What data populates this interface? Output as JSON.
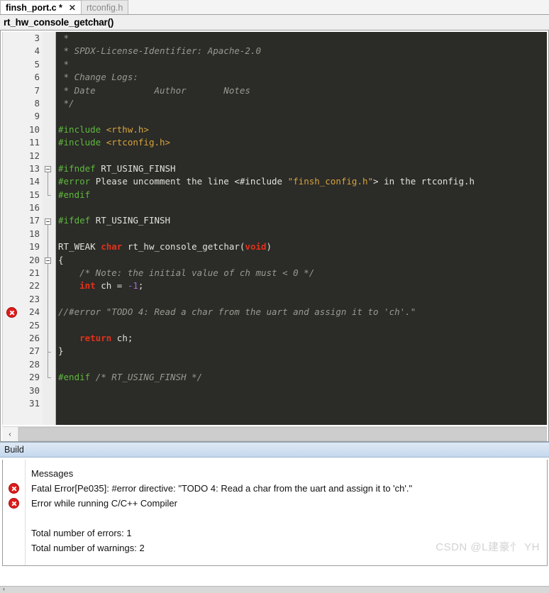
{
  "tabs": [
    {
      "label": "finsh_port.c *",
      "active": true,
      "close_icon": "✕"
    },
    {
      "label": "rtconfig.h",
      "active": false
    }
  ],
  "navbar": {
    "function_title": "rt_hw_console_getchar()"
  },
  "editor": {
    "first_visible_line": 3,
    "last_visible_line": 31,
    "error_line": 24,
    "lines": [
      {
        "n": 3,
        "tokens": [
          {
            "t": " * ",
            "c": "cmt"
          }
        ]
      },
      {
        "n": 4,
        "tokens": [
          {
            "t": " * SPDX-License-Identifier: Apache-2.0",
            "c": "cmt"
          }
        ]
      },
      {
        "n": 5,
        "tokens": [
          {
            "t": " * ",
            "c": "cmt"
          }
        ]
      },
      {
        "n": 6,
        "tokens": [
          {
            "t": " * Change Logs:",
            "c": "cmt"
          }
        ]
      },
      {
        "n": 7,
        "tokens": [
          {
            "t": " * Date           Author       Notes",
            "c": "cmt"
          }
        ]
      },
      {
        "n": 8,
        "tokens": [
          {
            "t": " */",
            "c": "cmt"
          }
        ]
      },
      {
        "n": 9,
        "tokens": []
      },
      {
        "n": 10,
        "tokens": [
          {
            "t": "#include ",
            "c": "pp"
          },
          {
            "t": "<rthw.h>",
            "c": "str"
          }
        ]
      },
      {
        "n": 11,
        "tokens": [
          {
            "t": "#include ",
            "c": "pp"
          },
          {
            "t": "<rtconfig.h>",
            "c": "str"
          }
        ]
      },
      {
        "n": 12,
        "tokens": []
      },
      {
        "n": 13,
        "tokens": [
          {
            "t": "#ifndef ",
            "c": "pp"
          },
          {
            "t": "RT_USING_FINSH",
            "c": "pl"
          }
        ]
      },
      {
        "n": 14,
        "tokens": [
          {
            "t": "#error ",
            "c": "pp"
          },
          {
            "t": "Please uncomment the line <#include ",
            "c": "pl"
          },
          {
            "t": "\"finsh_config.h\"",
            "c": "str"
          },
          {
            "t": "> in the rtconfig.h",
            "c": "pl"
          }
        ]
      },
      {
        "n": 15,
        "tokens": [
          {
            "t": "#endif",
            "c": "pp"
          }
        ]
      },
      {
        "n": 16,
        "tokens": []
      },
      {
        "n": 17,
        "tokens": [
          {
            "t": "#ifdef ",
            "c": "pp"
          },
          {
            "t": "RT_USING_FINSH",
            "c": "pl"
          }
        ]
      },
      {
        "n": 18,
        "tokens": []
      },
      {
        "n": 19,
        "tokens": [
          {
            "t": "RT_WEAK ",
            "c": "pl"
          },
          {
            "t": "char",
            "c": "k"
          },
          {
            "t": " rt_hw_console_getchar(",
            "c": "pl"
          },
          {
            "t": "void",
            "c": "k"
          },
          {
            "t": ")",
            "c": "pl"
          }
        ]
      },
      {
        "n": 20,
        "tokens": [
          {
            "t": "{",
            "c": "pl"
          }
        ]
      },
      {
        "n": 21,
        "tokens": [
          {
            "t": "    /* Note: the initial value of ch must < 0 */",
            "c": "cmt"
          }
        ]
      },
      {
        "n": 22,
        "tokens": [
          {
            "t": "    ",
            "c": "pl"
          },
          {
            "t": "int",
            "c": "k"
          },
          {
            "t": " ch = ",
            "c": "pl"
          },
          {
            "t": "-1",
            "c": "num"
          },
          {
            "t": ";",
            "c": "pl"
          }
        ]
      },
      {
        "n": 23,
        "tokens": []
      },
      {
        "n": 24,
        "tokens": [
          {
            "t": "//#error \"TODO 4: Read a char from the uart and assign it to 'ch'.\"",
            "c": "cmt"
          }
        ]
      },
      {
        "n": 25,
        "tokens": []
      },
      {
        "n": 26,
        "tokens": [
          {
            "t": "    ",
            "c": "pl"
          },
          {
            "t": "return",
            "c": "k"
          },
          {
            "t": " ch;",
            "c": "pl"
          }
        ]
      },
      {
        "n": 27,
        "tokens": [
          {
            "t": "}",
            "c": "pl"
          }
        ]
      },
      {
        "n": 28,
        "tokens": []
      },
      {
        "n": 29,
        "tokens": [
          {
            "t": "#endif ",
            "c": "pp"
          },
          {
            "t": "/* RT_USING_FINSH */",
            "c": "cmt"
          }
        ]
      },
      {
        "n": 30,
        "tokens": []
      },
      {
        "n": 31,
        "tokens": []
      }
    ],
    "fold_markers": [
      13,
      17,
      20
    ],
    "scrollbar": {
      "left_arrow": "‹"
    }
  },
  "build_panel": {
    "title": "Build",
    "column_header": "Messages",
    "messages": [
      {
        "icon": "error-icon",
        "text": "Fatal Error[Pe035]: #error directive: \"TODO 4: Read a char from the uart and assign it to 'ch'.\""
      },
      {
        "icon": "error-icon",
        "text": "Error while running C/C++ Compiler"
      }
    ],
    "summary": [
      "Total number of errors: 1",
      "Total number of warnings: 2"
    ]
  },
  "watermark": "CSDN @L建豪忄 YH",
  "colors": {
    "editor_bg": "#2b2b28",
    "keyword": "#e1321a",
    "preprocessor": "#5fb83c",
    "string": "#d6a43a",
    "number": "#a06fd0",
    "comment": "#9a9a91",
    "error": "#e01b1b",
    "build_header": "#c5d8ee"
  }
}
